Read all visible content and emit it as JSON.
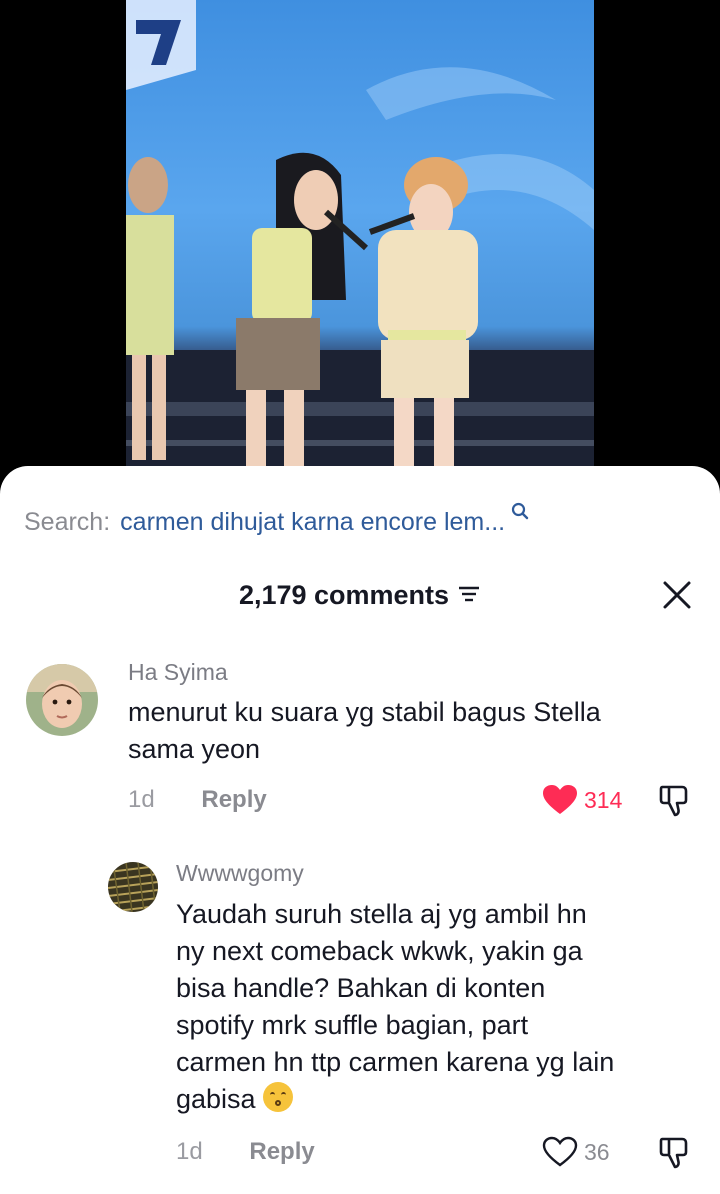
{
  "search": {
    "prefix": "Search:",
    "query": "carmen dihujat karna encore lem..."
  },
  "comments_header": {
    "count_label": "2,179 comments"
  },
  "colors": {
    "like_active": "#fe2c55",
    "search_link": "#2f5b9a",
    "muted_text": "#8a8b91"
  },
  "comments": [
    {
      "username": "Ha Syima",
      "text_line1": "menurut ku suara yg stabil bagus Stella",
      "text_line2": "sama yeon",
      "time": "1d",
      "reply_label": "Reply",
      "likes": "314",
      "liked": true
    },
    {
      "username": "Wwwwgomy",
      "text_lines": [
        "Yaudah suruh stella aj yg ambil hn",
        "ny next comeback wkwk, yakin ga",
        "bisa handle? Bahkan di konten",
        "spotify mrk suffle bagian, part",
        "carmen hn ttp carmen karena yg lain",
        "gabisa"
      ],
      "emoji": "kissing-face",
      "time": "1d",
      "reply_label": "Reply",
      "likes": "36",
      "liked": false
    }
  ]
}
